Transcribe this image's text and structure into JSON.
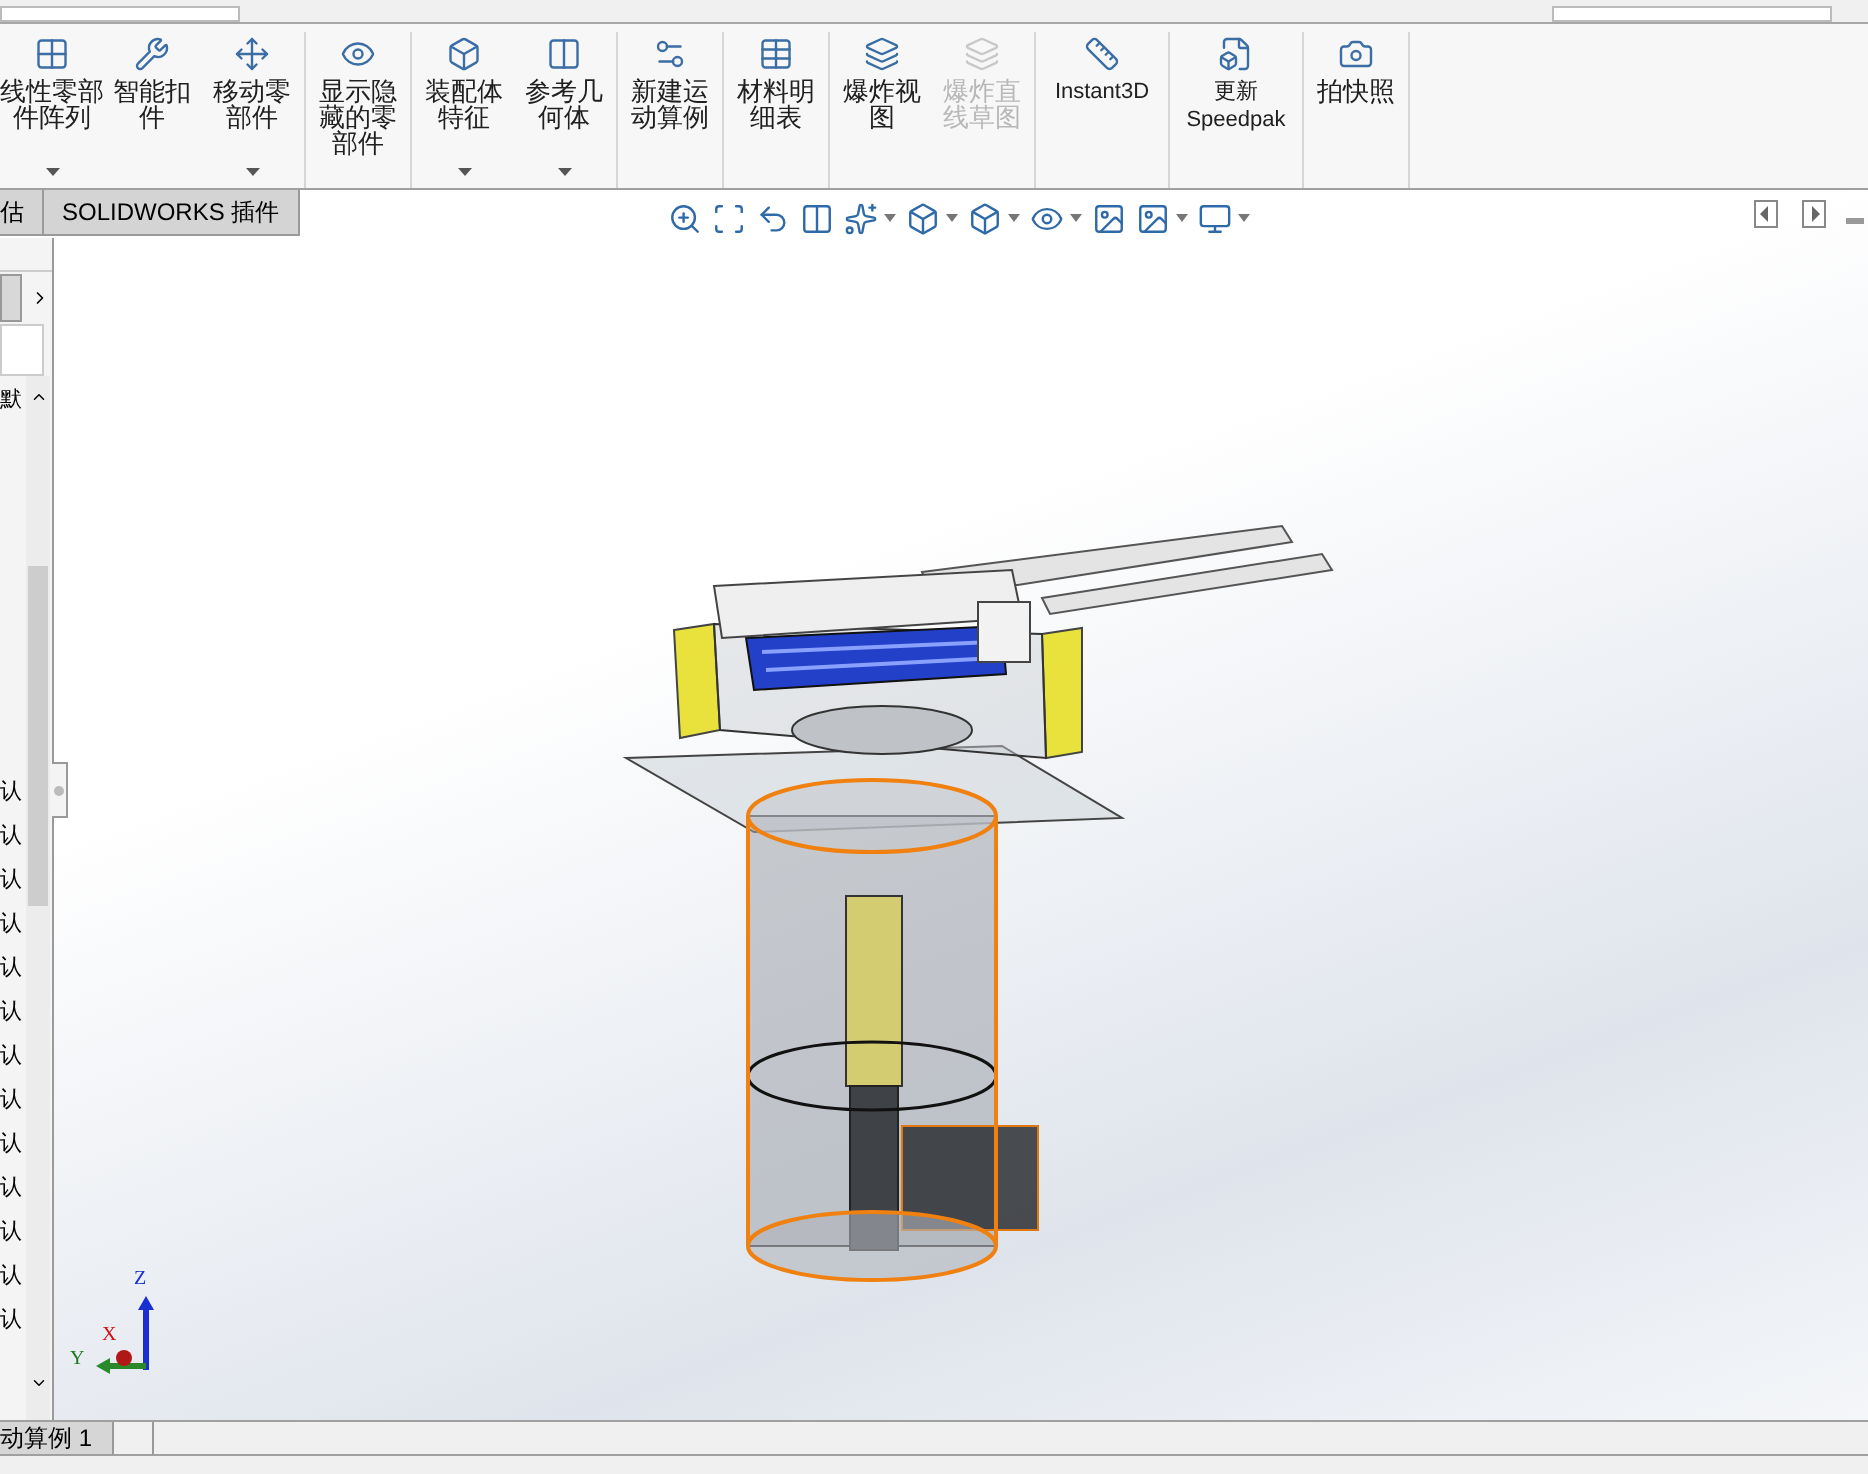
{
  "ribbon": {
    "groups": [
      [
        {
          "label": "线性零部件阵列",
          "caret": true,
          "disabled": false
        },
        {
          "label": "智能扣件",
          "caret": false,
          "disabled": false
        },
        {
          "label": "移动零部件",
          "caret": true,
          "disabled": false
        }
      ],
      [
        {
          "label": "显示隐藏的零部件",
          "caret": false,
          "disabled": false
        }
      ],
      [
        {
          "label": "装配体特征",
          "caret": true,
          "disabled": false
        },
        {
          "label": "参考几何体",
          "caret": true,
          "disabled": false
        }
      ],
      [
        {
          "label": "新建运动算例",
          "caret": false,
          "disabled": false
        }
      ],
      [
        {
          "label": "材料明细表",
          "caret": false,
          "disabled": false
        }
      ],
      [
        {
          "label": "爆炸视图",
          "caret": false,
          "disabled": false
        },
        {
          "label": "爆炸直线草图",
          "caret": false,
          "disabled": true
        }
      ],
      [
        {
          "label": "Instant3D",
          "caret": false,
          "disabled": false
        }
      ],
      [
        {
          "label": "更新 Speedpak",
          "caret": false,
          "disabled": false
        }
      ],
      [
        {
          "label": "拍快照",
          "caret": false,
          "disabled": false
        }
      ]
    ]
  },
  "tabs": [
    {
      "label": "估",
      "selected": false
    },
    {
      "label": "SOLIDWORKS 插件",
      "selected": false
    }
  ],
  "tree": {
    "header": "默",
    "rows": [
      "认",
      "认",
      "认",
      "认",
      "认",
      "认",
      "认",
      "认",
      "认",
      "认",
      "认",
      "认",
      "认"
    ]
  },
  "triad": {
    "z": "Z",
    "x": "X",
    "y": "Y"
  },
  "bottom_tabs": [
    {
      "label": "动算例 1",
      "selected": true
    }
  ]
}
